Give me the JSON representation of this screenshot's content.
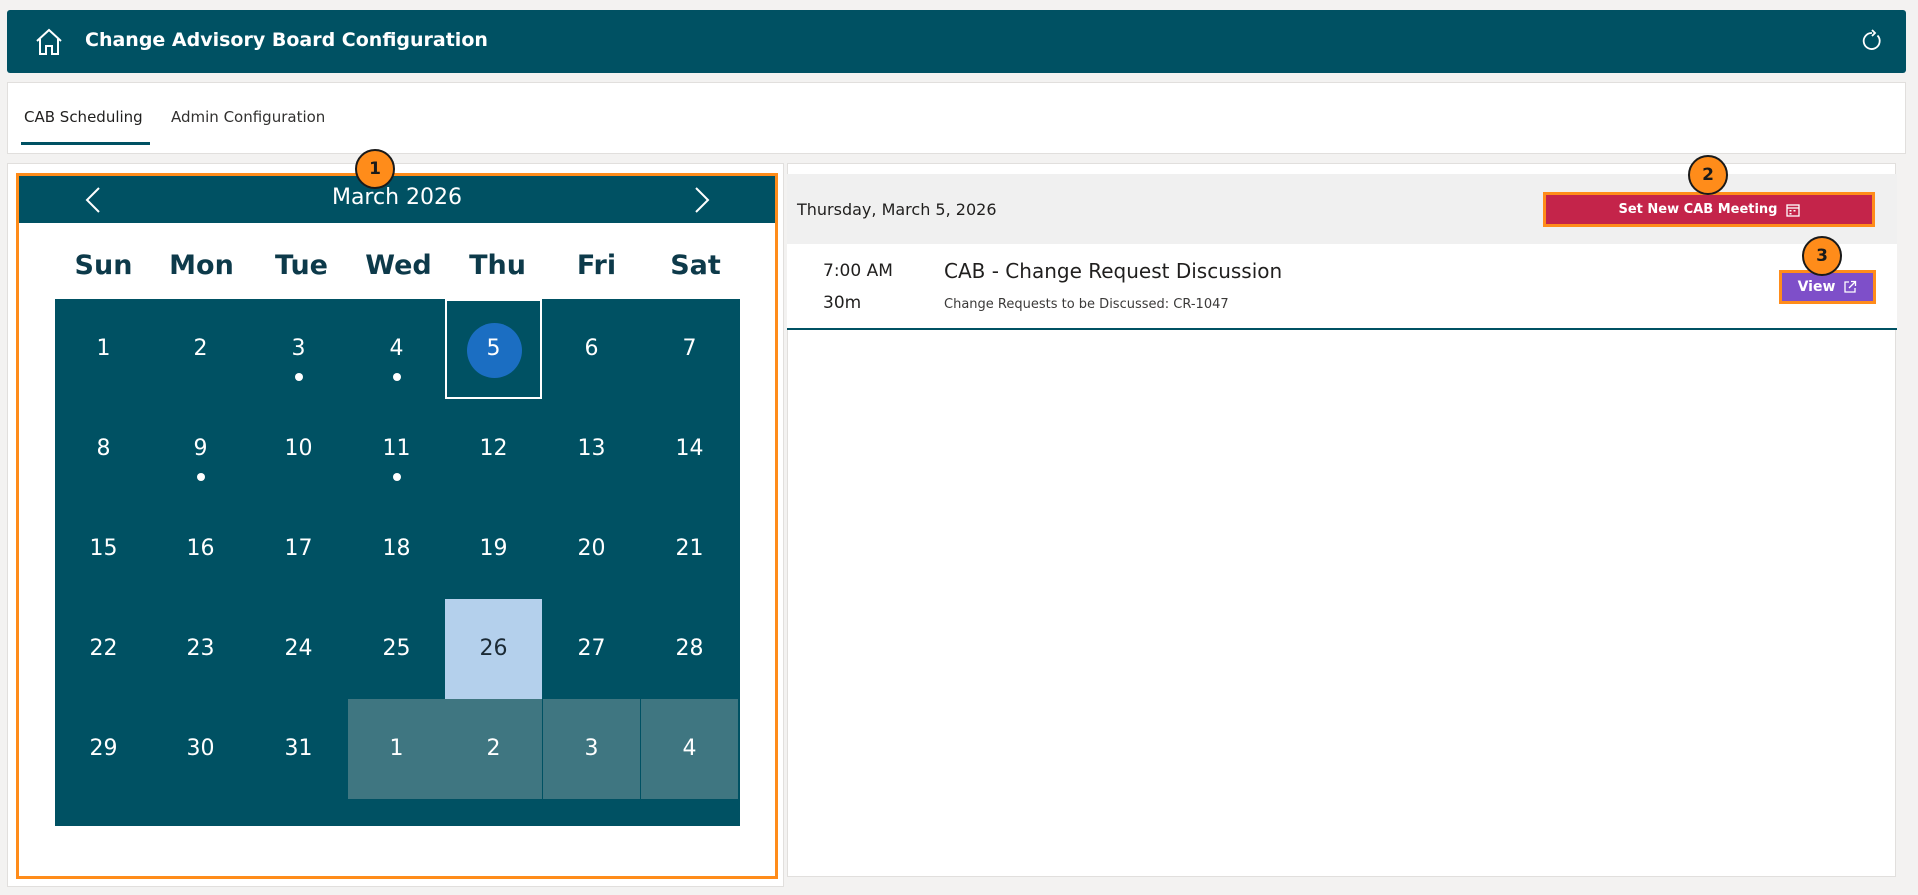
{
  "header": {
    "title": "Change Advisory Board Configuration",
    "home_icon": "home-icon",
    "refresh_icon": "refresh-icon",
    "background": "#005163"
  },
  "tabs": [
    {
      "label": "CAB Scheduling",
      "active": true
    },
    {
      "label": "Admin Configuration",
      "active": false
    }
  ],
  "calendar": {
    "month_label": "March 2026",
    "weekdays": [
      "Sun",
      "Mon",
      "Tue",
      "Wed",
      "Thu",
      "Fri",
      "Sat"
    ],
    "weeks": [
      [
        {
          "d": "1"
        },
        {
          "d": "2"
        },
        {
          "d": "3",
          "dot": true
        },
        {
          "d": "4",
          "dot": true
        },
        {
          "d": "5",
          "today": true
        },
        {
          "d": "6"
        },
        {
          "d": "7"
        }
      ],
      [
        {
          "d": "8"
        },
        {
          "d": "9",
          "dot": true
        },
        {
          "d": "10"
        },
        {
          "d": "11",
          "dot": true
        },
        {
          "d": "12"
        },
        {
          "d": "13"
        },
        {
          "d": "14"
        }
      ],
      [
        {
          "d": "15"
        },
        {
          "d": "16"
        },
        {
          "d": "17"
        },
        {
          "d": "18"
        },
        {
          "d": "19"
        },
        {
          "d": "20"
        },
        {
          "d": "21"
        }
      ],
      [
        {
          "d": "22"
        },
        {
          "d": "23"
        },
        {
          "d": "24"
        },
        {
          "d": "25"
        },
        {
          "d": "26",
          "highlight": true
        },
        {
          "d": "27"
        },
        {
          "d": "28"
        }
      ],
      [
        {
          "d": "29"
        },
        {
          "d": "30"
        },
        {
          "d": "31"
        },
        {
          "d": "1",
          "other": true
        },
        {
          "d": "2",
          "other": true
        },
        {
          "d": "3",
          "other": true
        },
        {
          "d": "4",
          "other": true
        }
      ]
    ],
    "colors": {
      "grid": "#005163",
      "today": "#1b6ec2",
      "highlight": "#b4d0ec",
      "other_month": "#3f7681"
    }
  },
  "details": {
    "date_label": "Thursday, March 5, 2026",
    "new_meeting_label": "Set New CAB Meeting",
    "meetings": [
      {
        "time": "7:00 AM",
        "duration": "30m",
        "title": "CAB - Change Request Discussion",
        "subtitle": "Change Requests to be Discussed: CR-1047",
        "view_label": "View"
      }
    ]
  },
  "markers": [
    "1",
    "2",
    "3"
  ],
  "accent": {
    "marker": "#ff8c1a",
    "new_button": "#c4244a",
    "view_button": "#7e4fc9"
  }
}
